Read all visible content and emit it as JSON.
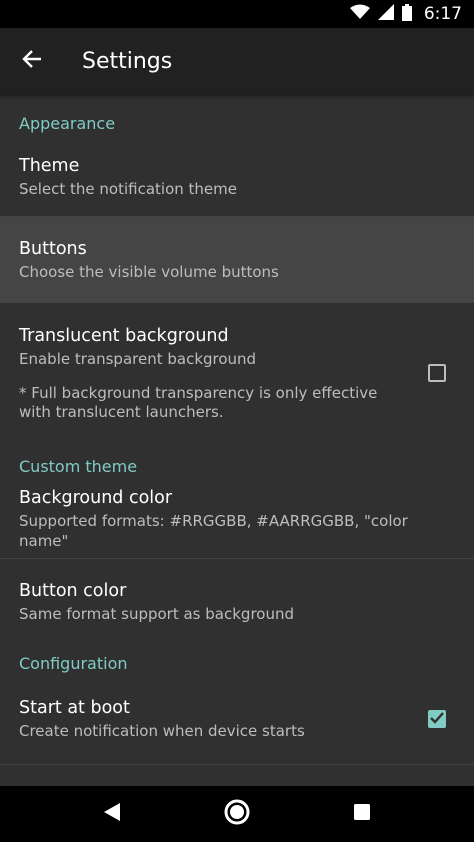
{
  "status_bar": {
    "time": "6:17",
    "icons": [
      "wifi-icon",
      "signal-icon",
      "battery-icon"
    ]
  },
  "app_bar": {
    "title": "Settings",
    "back_icon": "arrow-left-icon"
  },
  "colors": {
    "accent": "#80cbc4",
    "background": "#303030",
    "app_bar": "#212121",
    "highlight": "#454545"
  },
  "sections": {
    "appearance": {
      "header": "Appearance",
      "theme": {
        "title": "Theme",
        "summary": "Select the notification theme"
      },
      "buttons": {
        "title": "Buttons",
        "summary": "Choose the visible volume buttons"
      },
      "translucent": {
        "title": "Translucent background",
        "summary": "Enable transparent background",
        "note": "* Full background transparency is only effective with translucent launchers.",
        "checked": false
      }
    },
    "custom_theme": {
      "header": "Custom theme",
      "background_color": {
        "title": "Background color",
        "summary": "Supported formats: #RRGGBB, #AARRGGBB, \"color name\""
      },
      "button_color": {
        "title": "Button color",
        "summary": "Same format support as background"
      }
    },
    "configuration": {
      "header": "Configuration",
      "start_at_boot": {
        "title": "Start at boot",
        "summary": "Create notification when device starts",
        "checked": true
      }
    }
  },
  "nav_bar": {
    "icons": [
      "back-triangle-icon",
      "home-circle-icon",
      "recents-square-icon"
    ]
  }
}
